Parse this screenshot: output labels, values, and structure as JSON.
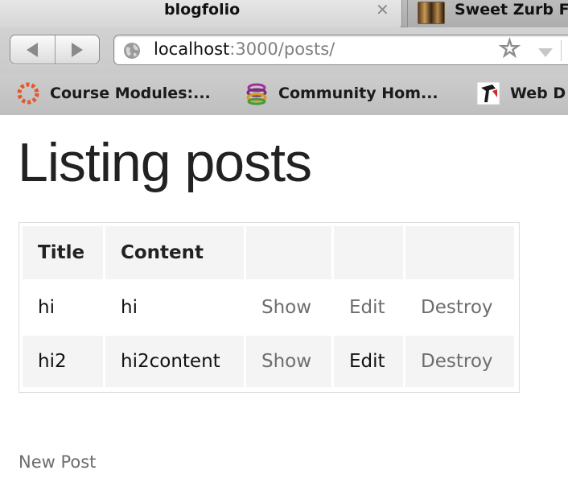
{
  "browser": {
    "tabs": [
      {
        "title": "blogfolio",
        "active": true
      },
      {
        "title": "Sweet Zurb F",
        "active": false
      }
    ],
    "url": {
      "host": "localhost",
      "rest": ":3000/posts/"
    },
    "bookmarks": [
      {
        "label": "Course Modules:...",
        "icon": "course-modules-icon"
      },
      {
        "label": "Community Hom...",
        "icon": "community-icon"
      },
      {
        "label": "Web D",
        "icon": "web-dev-icon"
      }
    ]
  },
  "page": {
    "title": "Listing posts",
    "table": {
      "headers": [
        "Title",
        "Content",
        "",
        "",
        ""
      ],
      "rows": [
        {
          "title": "hi",
          "content": "hi",
          "show": "Show",
          "edit": "Edit",
          "destroy": "Destroy"
        },
        {
          "title": "hi2",
          "content": "hi2content",
          "show": "Show",
          "edit": "Edit",
          "destroy": "Destroy"
        }
      ]
    },
    "new_post_label": "New Post"
  },
  "colors": {
    "link": "#6d6d6d",
    "header_bg": "#f4f4f4",
    "title_text": "#222222"
  }
}
